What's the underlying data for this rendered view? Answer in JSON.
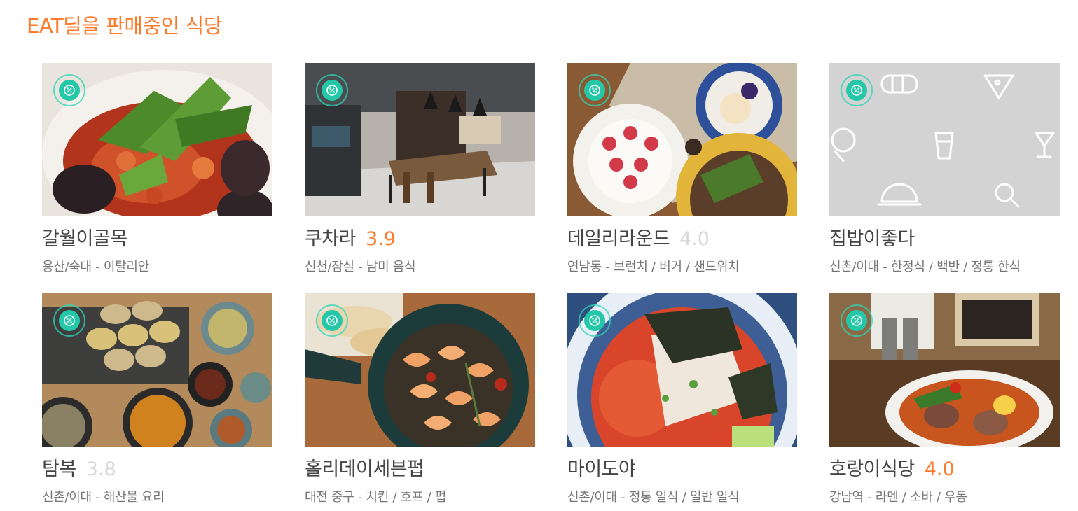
{
  "section": {
    "title": "EAT딜을 판매중인 식당"
  },
  "colors": {
    "accent": "#ff792a",
    "badge": "#24c8a8",
    "rating_muted": "#d8d8d8"
  },
  "restaurants": [
    {
      "name": "갈월이골목",
      "rating": "",
      "rating_muted": false,
      "meta": "용산/숙대 - 이탈리안",
      "badge_icon": "percent-deal-icon",
      "image": "pasta-photo"
    },
    {
      "name": "쿠차라",
      "rating": "3.9",
      "rating_muted": false,
      "meta": "신천/잠실 - 남미 음식",
      "badge_icon": "percent-deal-icon",
      "image": "restaurant-interior-photo"
    },
    {
      "name": "데일리라운드",
      "rating": "4.0",
      "rating_muted": true,
      "meta": "연남동 - 브런치 / 버거 / 샌드위치",
      "badge_icon": "percent-deal-icon",
      "image": "brunch-plates-photo"
    },
    {
      "name": "집밥이좋다",
      "rating": "",
      "rating_muted": false,
      "meta": "신촌/이대 - 한정식 / 백반 / 정통 한식",
      "badge_icon": "percent-deal-icon",
      "image": "placeholder-food-icons"
    },
    {
      "name": "탐복",
      "rating": "3.8",
      "rating_muted": true,
      "meta": "신촌/이대 - 해산물 요리",
      "badge_icon": "percent-deal-icon",
      "image": "abalone-photo"
    },
    {
      "name": "홀리데이세븐펍",
      "rating": "",
      "rating_muted": false,
      "meta": "대전 중구 - 치킨 / 호프 / 펍",
      "badge_icon": "percent-deal-icon",
      "image": "shrimp-skillet-photo"
    },
    {
      "name": "마이도야",
      "rating": "",
      "rating_muted": false,
      "meta": "신촌/이대 - 정통 일식 / 일반 일식",
      "badge_icon": "percent-deal-icon",
      "image": "mulhoe-bowl-photo"
    },
    {
      "name": "호랑이식당",
      "rating": "4.0",
      "rating_muted": false,
      "meta": "강남역 - 라멘 / 소바 / 우동",
      "badge_icon": "percent-deal-icon",
      "image": "ramen-photo"
    }
  ]
}
